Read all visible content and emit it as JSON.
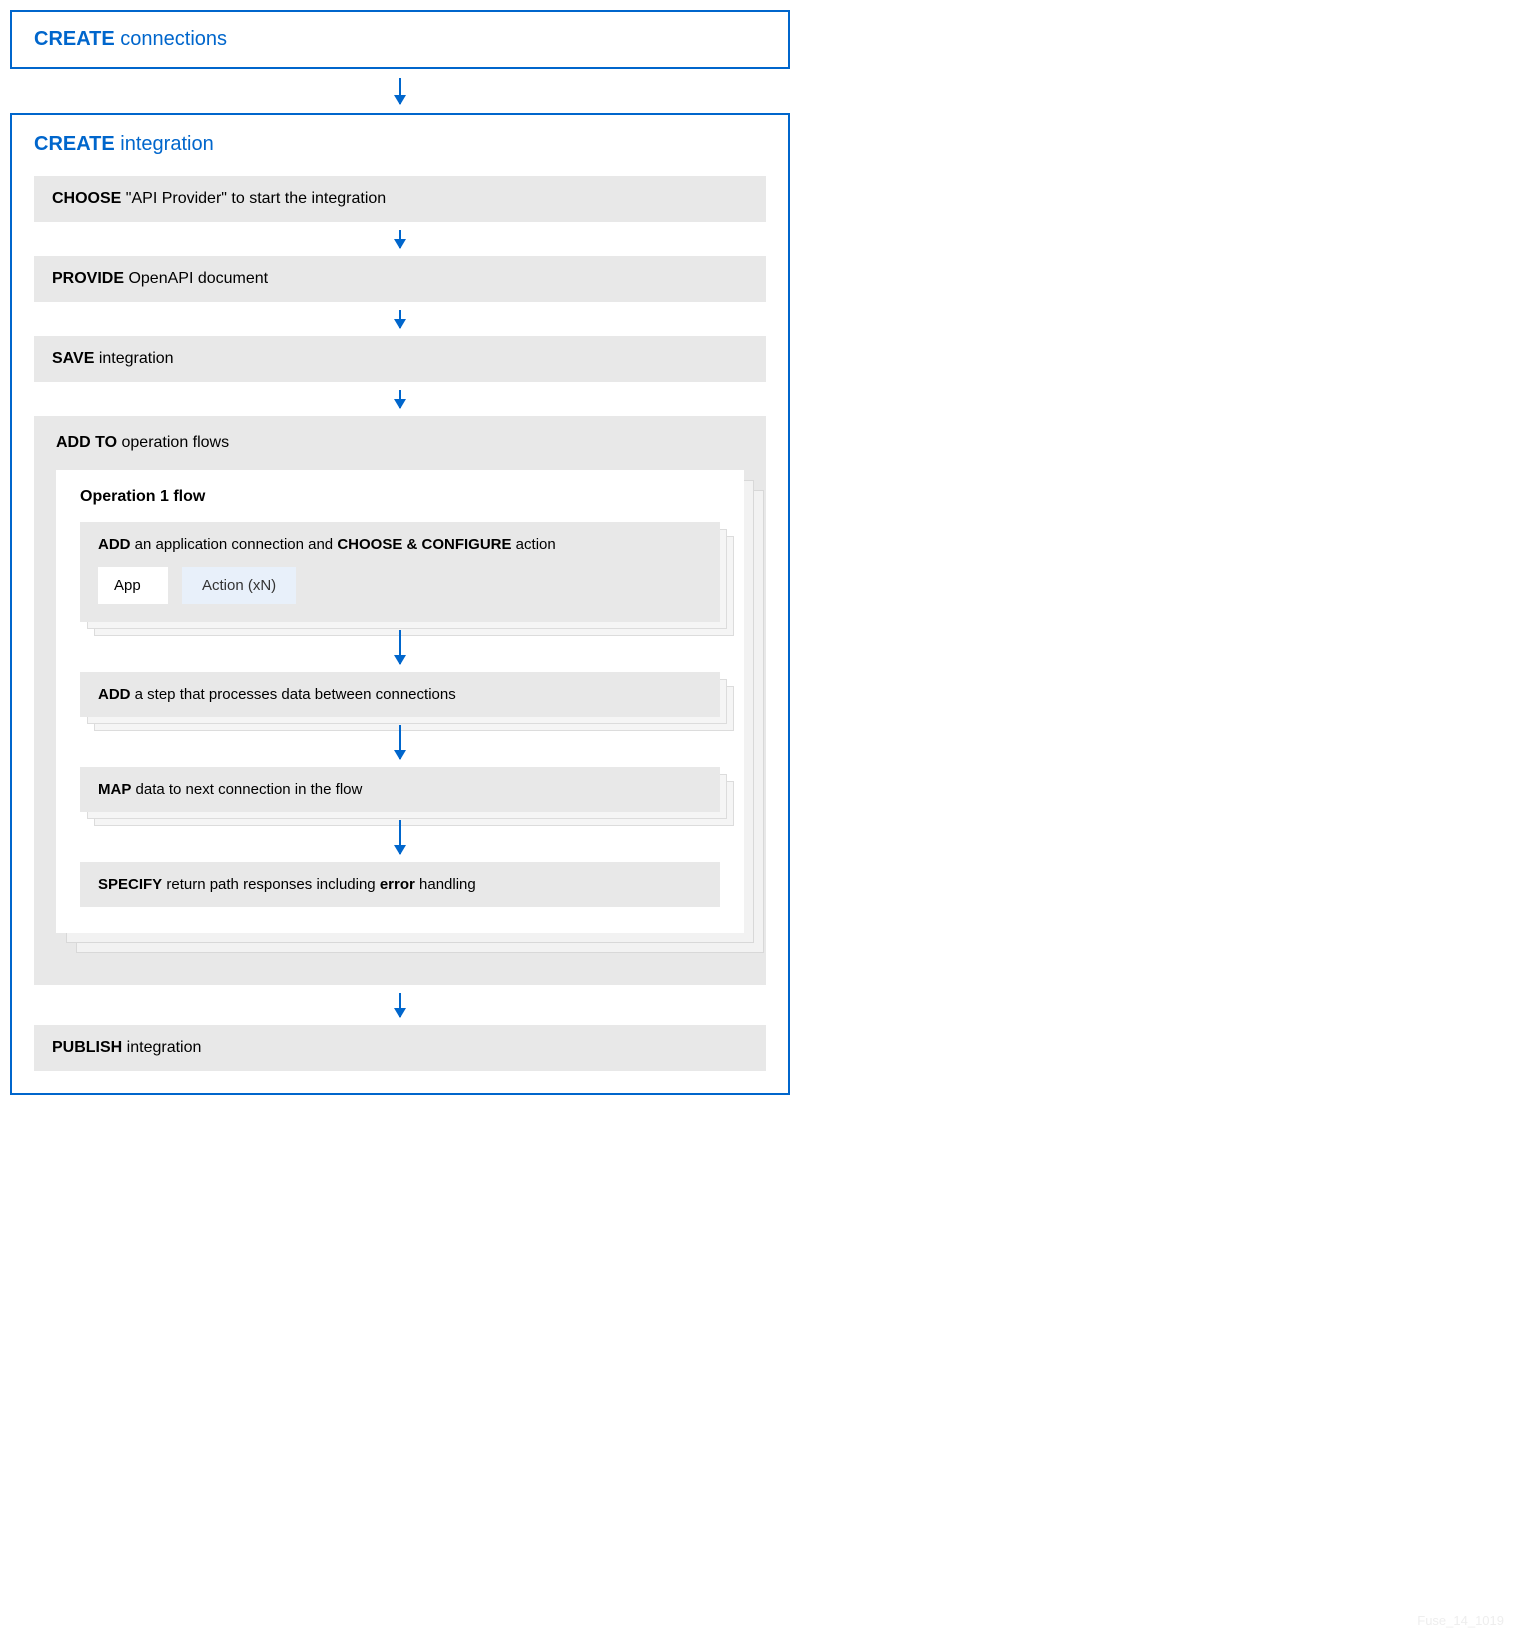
{
  "top": {
    "verb": "CREATE",
    "rest": " connections"
  },
  "main": {
    "title": {
      "verb": "CREATE",
      "rest": " integration"
    },
    "choose": {
      "verb": "CHOOSE",
      "rest": "  \"API Provider\" to start the integration"
    },
    "provide": {
      "verb": "PROVIDE",
      "rest": " OpenAPI document"
    },
    "save": {
      "verb": "SAVE",
      "rest": " integration"
    },
    "addto": {
      "verb": "ADD TO",
      "rest": " operation flows"
    },
    "opflow": {
      "title": "Operation 1 flow",
      "addconn": {
        "p1": "ADD",
        "p2": " an application connection and ",
        "p3": "CHOOSE & CONFIGURE",
        "p4": " action"
      },
      "app": "App",
      "action": "Action (xN)",
      "addstep": {
        "verb": "ADD",
        "rest": " a step that processes data between connections"
      },
      "map": {
        "verb": "MAP",
        "rest": " data to next connection in the flow"
      },
      "specify": {
        "p1": "SPECIFY",
        "p2": " return path responses including ",
        "p3": "error",
        "p4": " handling"
      }
    },
    "publish": {
      "verb": "PUBLISH",
      "rest": " integration"
    }
  },
  "footer": "Fuse_14_1019"
}
